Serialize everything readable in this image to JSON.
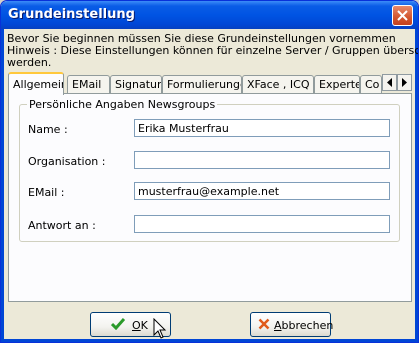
{
  "window": {
    "title": "Grundeinstellung"
  },
  "intro": {
    "line1": "Bevor Sie beginnen müssen Sie diese Grundeinstellungen vornemmen",
    "line2": "Hinweis : Diese Einstellungen können für einzelne Server / Gruppen überschrieben",
    "line3": "werden."
  },
  "tabs": [
    {
      "label": "Allgemein",
      "active": true
    },
    {
      "label": "EMail"
    },
    {
      "label": "Signatur"
    },
    {
      "label": "Formulierungen"
    },
    {
      "label": "XFace , ICQ"
    },
    {
      "label": "Experte"
    },
    {
      "label": "Co"
    }
  ],
  "group": {
    "label": "Persönliche Angaben Newsgroups"
  },
  "fields": [
    {
      "label": "Name :",
      "value": "Erika Musterfrau"
    },
    {
      "label": "Organisation :",
      "value": ""
    },
    {
      "label": "EMail :",
      "value": "musterfrau@example.net"
    },
    {
      "label": "Antwort an :",
      "value": ""
    }
  ],
  "buttons": {
    "ok": {
      "first": "O",
      "rest": "K"
    },
    "cancel": {
      "first": "A",
      "rest": "bbrechen"
    }
  },
  "colors": {
    "ok_check": "#2a9a2a",
    "cancel_x": "#e05a1a",
    "title_bar": "#0054e3",
    "active_tab_accent": "#ffc83c"
  }
}
